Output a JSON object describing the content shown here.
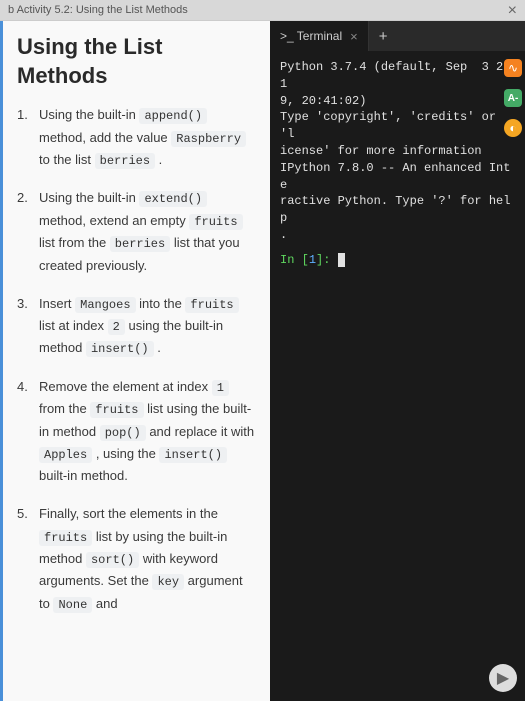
{
  "breadcrumb": "b Activity 5.2: Using the List Methods",
  "page_title": "Using the List Methods",
  "steps": [
    {
      "num": "1.",
      "parts": [
        "Using the built-in ",
        {
          "code": "append()"
        },
        " method, add the value ",
        {
          "code": "Raspberry"
        },
        " to the list ",
        {
          "code": "berries"
        },
        " ."
      ]
    },
    {
      "num": "2.",
      "parts": [
        "Using the built-in ",
        {
          "code": "extend()"
        },
        " method, extend an empty ",
        {
          "code": "fruits"
        },
        " list from the ",
        {
          "code": "berries"
        },
        " list that you created previously."
      ]
    },
    {
      "num": "3.",
      "parts": [
        "Insert ",
        {
          "code": "Mangoes"
        },
        " into the ",
        {
          "code": "fruits"
        },
        " list at index ",
        {
          "code": "2"
        },
        " using the built-in method ",
        {
          "code": "insert()"
        },
        " ."
      ]
    },
    {
      "num": "4.",
      "parts": [
        "Remove the element at index ",
        {
          "code": "1"
        },
        " from the ",
        {
          "code": "fruits"
        },
        " list using the built-in method ",
        {
          "code": "pop()"
        },
        " and replace it with ",
        {
          "code": "Apples"
        },
        " , using the ",
        {
          "code": "insert()"
        },
        " built-in method."
      ]
    },
    {
      "num": "5.",
      "parts": [
        "Finally, sort the elements in the ",
        {
          "code": "fruits"
        },
        " list by using the built-in method ",
        {
          "code": "sort()"
        },
        " with keyword arguments. Set the ",
        {
          "code": "key"
        },
        " argument to ",
        {
          "code": "None"
        },
        " and"
      ]
    }
  ],
  "terminal": {
    "tab_label": ">_ Terminal",
    "output_lines": [
      "Python 3.7.4 (default, Sep  3 201",
      "9, 20:41:02)",
      "Type 'copyright', 'credits' or 'l",
      "icense' for more information",
      "IPython 7.8.0 -- An enhanced Inte",
      "ractive Python. Type '?' for help",
      "."
    ],
    "prompt_in": "In [",
    "prompt_num": "1",
    "prompt_close": "]: "
  },
  "icons": {
    "close": "×",
    "add": "+",
    "play": "▶"
  }
}
